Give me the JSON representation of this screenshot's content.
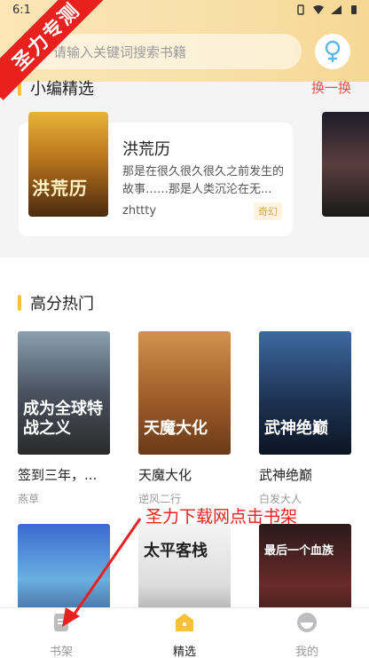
{
  "status": {
    "time": "6:1"
  },
  "search": {
    "placeholder": "请输入关键词搜索书籍"
  },
  "watermark": "圣力专测",
  "picks": {
    "title": "小编精选",
    "swap_label": "换一换",
    "book": {
      "cover_text": "洪荒历",
      "title": "洪荒历",
      "desc": "那是在很久很久很久之前发生的故事……那是人类沉沦在无...",
      "author": "zhttty",
      "tag": "奇幻"
    }
  },
  "hot": {
    "title": "高分热门",
    "books": [
      {
        "cover_text": "成为全球特战之义",
        "title": "签到三年，...",
        "author": "燕草"
      },
      {
        "cover_text": "天魔大化",
        "title": "天魔大化",
        "author": "逆风二行"
      },
      {
        "cover_text": "武神绝巅",
        "title": "武神绝巅",
        "author": "白发大人"
      },
      {
        "cover_text": "",
        "title": "",
        "author": ""
      },
      {
        "cover_text": "太平客栈",
        "title": "",
        "author": ""
      },
      {
        "cover_text": "最后一个血族",
        "title": "",
        "author": ""
      }
    ]
  },
  "annotation": "圣力下载网点击书架",
  "nav": [
    {
      "label": "书架",
      "icon": "book-icon"
    },
    {
      "label": "精选",
      "icon": "home-icon"
    },
    {
      "label": "我的",
      "icon": "profile-icon"
    }
  ],
  "colors": {
    "accent": "#f5c23a",
    "warning": "#e8201e"
  }
}
